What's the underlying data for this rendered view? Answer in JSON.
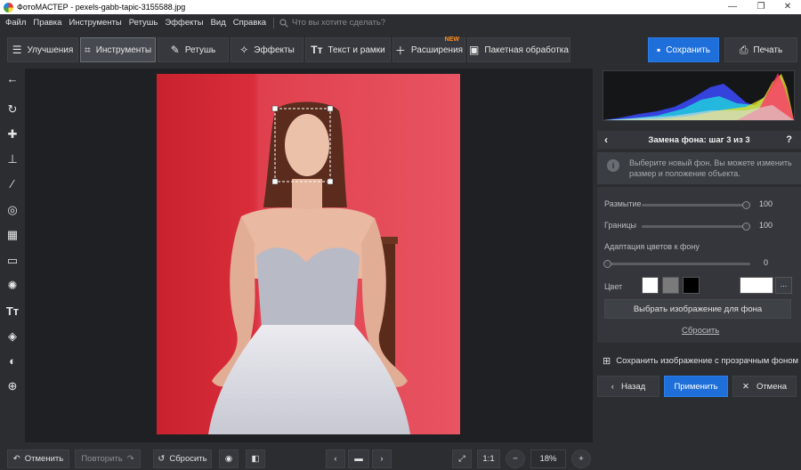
{
  "window": {
    "app_name": "ФотоМАСТЕР",
    "file_name": "pexels-gabb-tapic-3155588.jpg",
    "controls": {
      "minimize": "—",
      "maximize": "❐",
      "close": "✕"
    }
  },
  "menu": {
    "items": [
      "Файл",
      "Правка",
      "Инструменты",
      "Ретушь",
      "Эффекты",
      "Вид",
      "Справка"
    ],
    "search_placeholder": "Что вы хотите сделать?"
  },
  "toolbar": {
    "tabs": [
      {
        "label": "Улучшения",
        "icon": "sliders-icon"
      },
      {
        "label": "Инструменты",
        "icon": "crop-icon",
        "active": true
      },
      {
        "label": "Ретушь",
        "icon": "brush-icon"
      },
      {
        "label": "Эффекты",
        "icon": "magic-wand-icon"
      },
      {
        "label": "Текст и рамки",
        "icon": "text-icon"
      },
      {
        "label": "Расширения",
        "icon": "plus-icon",
        "badge": "NEW"
      },
      {
        "label": "Пакетная обработка",
        "icon": "batch-icon"
      }
    ],
    "save_label": "Сохранить",
    "print_label": "Печать"
  },
  "left_tools": [
    "back-arrow-icon",
    "rotate-icon",
    "bandage-icon",
    "stamp-icon",
    "brush-icon",
    "target-icon",
    "gradient-icon",
    "vignette-icon",
    "light-icon",
    "text-tool-icon",
    "fill-bucket-icon",
    "eraser-icon",
    "globe-icon"
  ],
  "panel": {
    "title": "Замена фона: шаг 3 из 3",
    "help": "?",
    "info_text": "Выберите новый фон. Вы можете изменить размер и положение объекта.",
    "blur": {
      "label": "Размытие",
      "value": "100",
      "level": 1.0
    },
    "borders": {
      "label": "Границы",
      "value": "100",
      "level": 1.0
    },
    "adaptation": {
      "label": "Адаптация цветов к фону",
      "value": "0",
      "level": 0.0
    },
    "color_label": "Цвет",
    "swatches": [
      "#ffffff",
      "#7a7a7a",
      "#000000"
    ],
    "custom_color": "#ffffff",
    "more": "...",
    "choose_image": "Выбрать изображение для фона",
    "reset_link": "Сбросить",
    "save_transparent": "Сохранить изображение с прозрачным фоном",
    "back": "Назад",
    "apply": "Применить",
    "cancel": "Отмена"
  },
  "bottom": {
    "undo": "Отменить",
    "redo": "Повторить",
    "reset": "Сбросить",
    "zoom_ratio": "1:1",
    "zoom_value": "18%"
  },
  "colors": {
    "accent": "#1e6fd9",
    "badge": "#ff8a1e",
    "background_red": "#d92d3b"
  }
}
